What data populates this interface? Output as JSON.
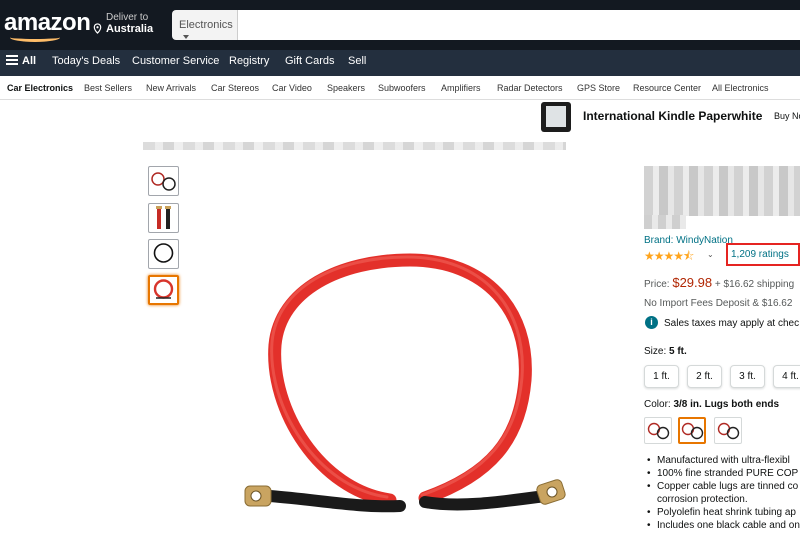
{
  "header": {
    "logo": "amazon",
    "deliver_line1": "Deliver to",
    "deliver_line2": "Australia",
    "search_category": "Electronics",
    "search_value": ""
  },
  "nav": {
    "all": "All",
    "items": [
      "Today's Deals",
      "Customer Service",
      "Registry",
      "Gift Cards",
      "Sell"
    ]
  },
  "subnav": {
    "items": [
      "Car Electronics",
      "Best Sellers",
      "New Arrivals",
      "Car Stereos",
      "Car Video",
      "Speakers",
      "Subwoofers",
      "Amplifiers",
      "Radar Detectors",
      "GPS Store",
      "Resource Center",
      "All Electronics"
    ]
  },
  "ad": {
    "title": "International Kindle Paperwhite",
    "cta": "Buy No"
  },
  "product": {
    "brand": "Brand: WindyNation",
    "stars_glyphs": "★★★★⯪",
    "ratings": "1,209 ratings",
    "price_label": "Price:",
    "price": "$29.98",
    "shipping": "+ $16.62 shipping",
    "import_fees": "No Import Fees Deposit & $16.62",
    "sales_tax": "Sales taxes may apply at chec",
    "size_label": "Size:",
    "size_value": "5 ft.",
    "sizes": [
      "1 ft.",
      "2 ft.",
      "3 ft.",
      "4 ft."
    ],
    "color_label": "Color:",
    "color_value": "3/8 in. Lugs both ends",
    "bullets": [
      "Manufactured with ultra-flexibl",
      "100% fine stranded PURE COP",
      "Copper cable lugs are tinned co",
      "corrosion protection.",
      "Polyolefin heat shrink tubing ap",
      "Includes one black cable and on"
    ]
  },
  "colors": {
    "header_bg": "#131921",
    "nav_bg": "#232f3e",
    "price": "#b12704",
    "link": "#007185",
    "star": "#ffa41c",
    "highlight_box": "#e52421",
    "selected": "#e77600",
    "cable": "#e3302a"
  }
}
